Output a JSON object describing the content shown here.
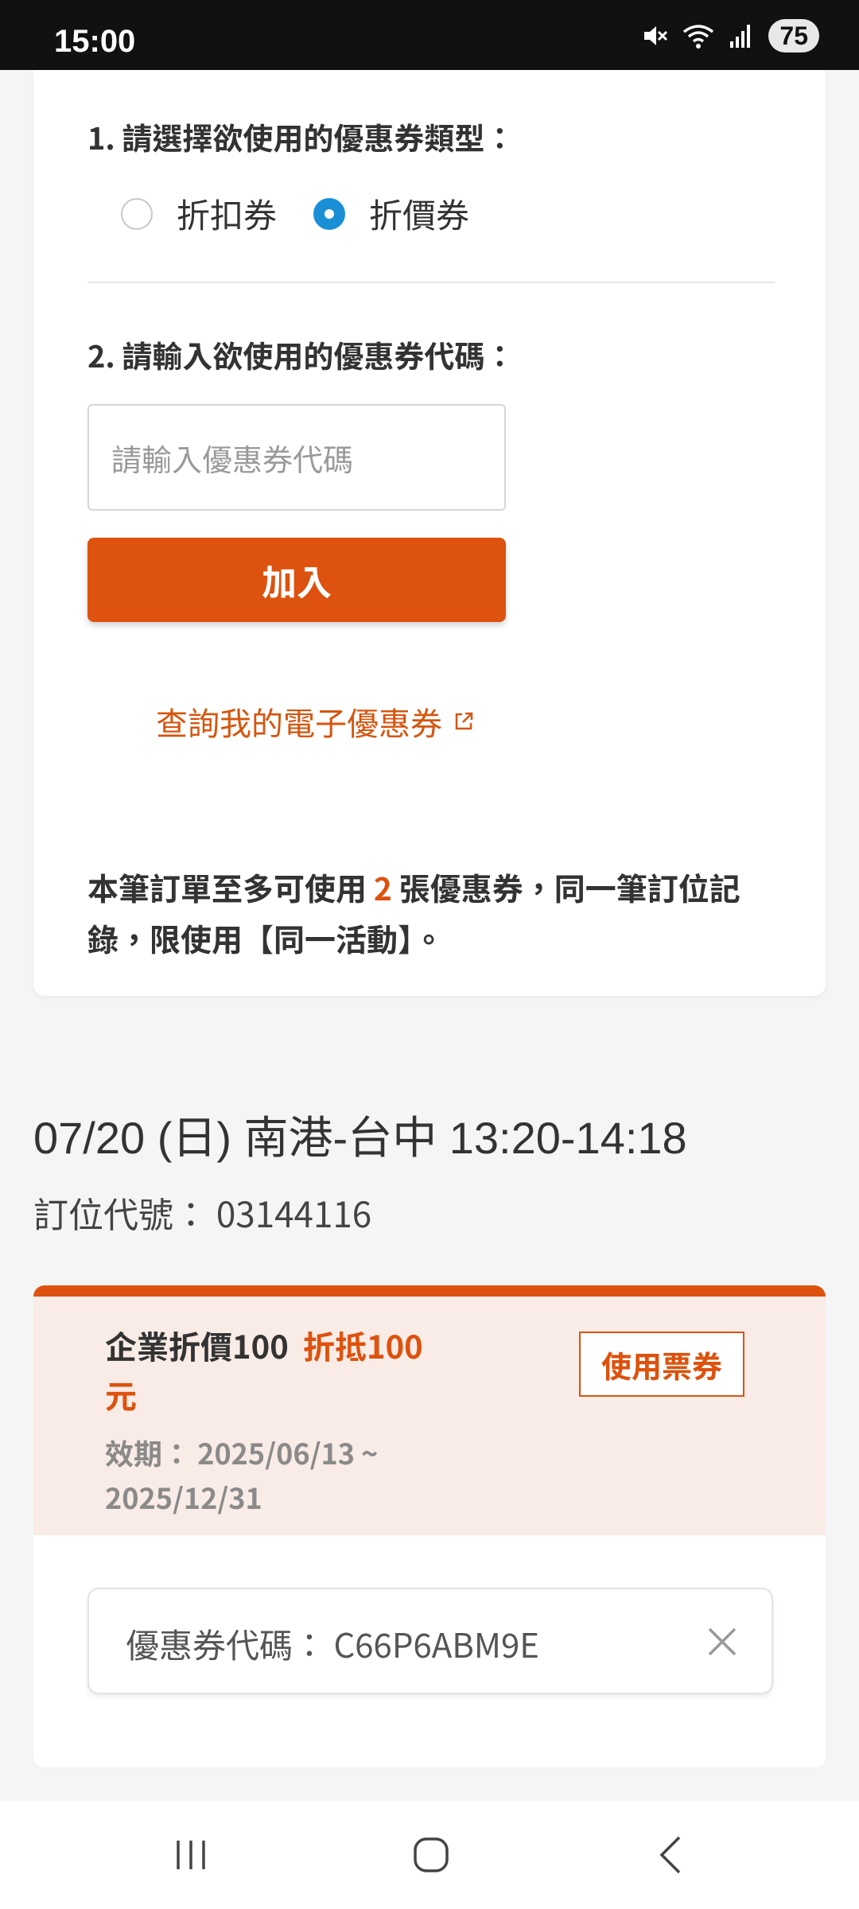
{
  "status_bar": {
    "time": "15:00",
    "battery": "75"
  },
  "coupon_form": {
    "step1_title": "1. 請選擇欲使用的優惠券類型：",
    "type_options": [
      {
        "label": "折扣券",
        "selected": false
      },
      {
        "label": "折價券",
        "selected": true
      }
    ],
    "step2_title": "2. 請輸入欲使用的優惠券代碼：",
    "code_placeholder": "請輸入優惠券代碼",
    "code_value": "",
    "join_label": "加入",
    "query_link": "查詢我的電子優惠券",
    "note_part1": "本筆訂單至多可使用 ",
    "note_count": "2",
    "note_part2": " 張優惠券，同一筆訂位記錄，限使用【同一活動】。"
  },
  "trip": {
    "title": "07/20 (日) 南港-台中 13:20-14:18",
    "pnr_label": "訂位代號：",
    "pnr": "03144116"
  },
  "coupon": {
    "name": "企業折價100",
    "amount": "折抵100元",
    "validity_label": "效期：",
    "validity_start": "2025/06/13",
    "validity_sep": " ~ ",
    "validity_end": "2025/12/31",
    "use_label": "使用票券",
    "code_label": "優惠券代碼：",
    "code": "C66P6ABM9E"
  },
  "colors": {
    "accent": "#dd520e",
    "radio_selected": "#1b8fd6",
    "coupon_bg": "#f9ebe5"
  },
  "icons": {
    "status": [
      "mute-icon",
      "wifi-icon",
      "signal-icon",
      "battery-icon"
    ],
    "link": "external-link-icon",
    "remove": "close-icon",
    "nav": [
      "recent-apps-icon",
      "home-icon",
      "back-icon"
    ]
  }
}
